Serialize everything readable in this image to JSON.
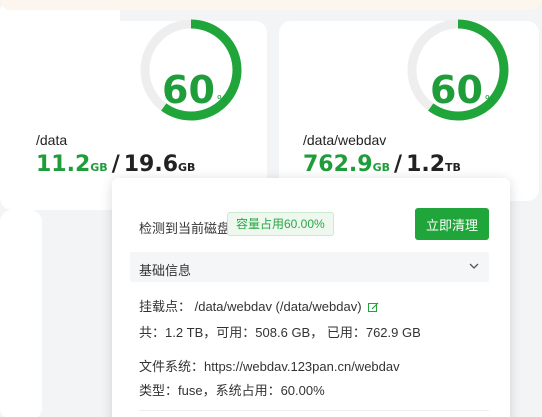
{
  "colors": {
    "accent": "#20a53a",
    "ring_track": "#eeeeee",
    "ring_fill": "#20a53a"
  },
  "disks": [
    {
      "path": "/data",
      "percent": 60,
      "percent_text": "60",
      "percent_unit": "%",
      "used_value": "11.2",
      "used_unit": "GB",
      "separator": "/",
      "total_value": "19.6",
      "total_unit": "GB"
    },
    {
      "path": "/data/webdav",
      "percent": 60,
      "percent_text": "60",
      "percent_unit": "%",
      "used_value": "762.9",
      "used_unit": "GB",
      "separator": "/",
      "total_value": "1.2",
      "total_unit": "TB"
    }
  ],
  "popover": {
    "detect_label": "检测到当前磁盘",
    "capacity_badge": "容量占用60.00%",
    "clean_button": "立即清理",
    "section_title": "基础信息",
    "chevron_icon": "chevron-down-icon",
    "mount_line": "挂载点： /data/webdav (/data/webdav)",
    "edit_icon": "edit-icon",
    "space_line": "共：1.2 TB，可用：508.6 GB， 已用：762.9 GB",
    "fs_line": "文件系统：https://webdav.123pan.cn/webdav",
    "type_line": "类型：fuse，系统占用：60.00%"
  }
}
